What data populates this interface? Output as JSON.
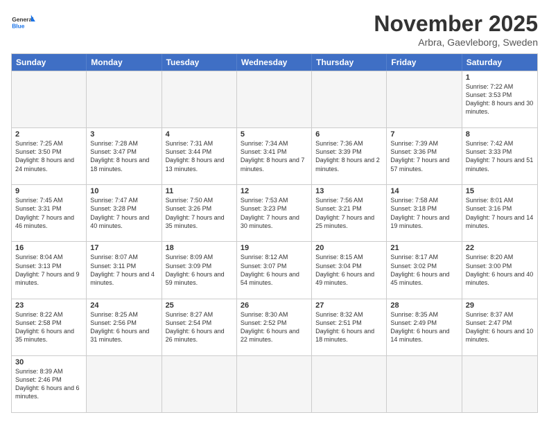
{
  "logo": {
    "text_general": "General",
    "text_blue": "Blue"
  },
  "header": {
    "month": "November 2025",
    "location": "Arbra, Gaevleborg, Sweden"
  },
  "days_of_week": [
    "Sunday",
    "Monday",
    "Tuesday",
    "Wednesday",
    "Thursday",
    "Friday",
    "Saturday"
  ],
  "weeks": [
    [
      {
        "day": "",
        "info": "",
        "empty": true
      },
      {
        "day": "",
        "info": "",
        "empty": true
      },
      {
        "day": "",
        "info": "",
        "empty": true
      },
      {
        "day": "",
        "info": "",
        "empty": true
      },
      {
        "day": "",
        "info": "",
        "empty": true
      },
      {
        "day": "",
        "info": "",
        "empty": true
      },
      {
        "day": "1",
        "info": "Sunrise: 7:22 AM\nSunset: 3:53 PM\nDaylight: 8 hours\nand 30 minutes.",
        "empty": false
      }
    ],
    [
      {
        "day": "2",
        "info": "Sunrise: 7:25 AM\nSunset: 3:50 PM\nDaylight: 8 hours\nand 24 minutes.",
        "empty": false
      },
      {
        "day": "3",
        "info": "Sunrise: 7:28 AM\nSunset: 3:47 PM\nDaylight: 8 hours\nand 18 minutes.",
        "empty": false
      },
      {
        "day": "4",
        "info": "Sunrise: 7:31 AM\nSunset: 3:44 PM\nDaylight: 8 hours\nand 13 minutes.",
        "empty": false
      },
      {
        "day": "5",
        "info": "Sunrise: 7:34 AM\nSunset: 3:41 PM\nDaylight: 8 hours\nand 7 minutes.",
        "empty": false
      },
      {
        "day": "6",
        "info": "Sunrise: 7:36 AM\nSunset: 3:39 PM\nDaylight: 8 hours\nand 2 minutes.",
        "empty": false
      },
      {
        "day": "7",
        "info": "Sunrise: 7:39 AM\nSunset: 3:36 PM\nDaylight: 7 hours\nand 57 minutes.",
        "empty": false
      },
      {
        "day": "8",
        "info": "Sunrise: 7:42 AM\nSunset: 3:33 PM\nDaylight: 7 hours\nand 51 minutes.",
        "empty": false
      }
    ],
    [
      {
        "day": "9",
        "info": "Sunrise: 7:45 AM\nSunset: 3:31 PM\nDaylight: 7 hours\nand 46 minutes.",
        "empty": false
      },
      {
        "day": "10",
        "info": "Sunrise: 7:47 AM\nSunset: 3:28 PM\nDaylight: 7 hours\nand 40 minutes.",
        "empty": false
      },
      {
        "day": "11",
        "info": "Sunrise: 7:50 AM\nSunset: 3:26 PM\nDaylight: 7 hours\nand 35 minutes.",
        "empty": false
      },
      {
        "day": "12",
        "info": "Sunrise: 7:53 AM\nSunset: 3:23 PM\nDaylight: 7 hours\nand 30 minutes.",
        "empty": false
      },
      {
        "day": "13",
        "info": "Sunrise: 7:56 AM\nSunset: 3:21 PM\nDaylight: 7 hours\nand 25 minutes.",
        "empty": false
      },
      {
        "day": "14",
        "info": "Sunrise: 7:58 AM\nSunset: 3:18 PM\nDaylight: 7 hours\nand 19 minutes.",
        "empty": false
      },
      {
        "day": "15",
        "info": "Sunrise: 8:01 AM\nSunset: 3:16 PM\nDaylight: 7 hours\nand 14 minutes.",
        "empty": false
      }
    ],
    [
      {
        "day": "16",
        "info": "Sunrise: 8:04 AM\nSunset: 3:13 PM\nDaylight: 7 hours\nand 9 minutes.",
        "empty": false
      },
      {
        "day": "17",
        "info": "Sunrise: 8:07 AM\nSunset: 3:11 PM\nDaylight: 7 hours\nand 4 minutes.",
        "empty": false
      },
      {
        "day": "18",
        "info": "Sunrise: 8:09 AM\nSunset: 3:09 PM\nDaylight: 6 hours\nand 59 minutes.",
        "empty": false
      },
      {
        "day": "19",
        "info": "Sunrise: 8:12 AM\nSunset: 3:07 PM\nDaylight: 6 hours\nand 54 minutes.",
        "empty": false
      },
      {
        "day": "20",
        "info": "Sunrise: 8:15 AM\nSunset: 3:04 PM\nDaylight: 6 hours\nand 49 minutes.",
        "empty": false
      },
      {
        "day": "21",
        "info": "Sunrise: 8:17 AM\nSunset: 3:02 PM\nDaylight: 6 hours\nand 45 minutes.",
        "empty": false
      },
      {
        "day": "22",
        "info": "Sunrise: 8:20 AM\nSunset: 3:00 PM\nDaylight: 6 hours\nand 40 minutes.",
        "empty": false
      }
    ],
    [
      {
        "day": "23",
        "info": "Sunrise: 8:22 AM\nSunset: 2:58 PM\nDaylight: 6 hours\nand 35 minutes.",
        "empty": false
      },
      {
        "day": "24",
        "info": "Sunrise: 8:25 AM\nSunset: 2:56 PM\nDaylight: 6 hours\nand 31 minutes.",
        "empty": false
      },
      {
        "day": "25",
        "info": "Sunrise: 8:27 AM\nSunset: 2:54 PM\nDaylight: 6 hours\nand 26 minutes.",
        "empty": false
      },
      {
        "day": "26",
        "info": "Sunrise: 8:30 AM\nSunset: 2:52 PM\nDaylight: 6 hours\nand 22 minutes.",
        "empty": false
      },
      {
        "day": "27",
        "info": "Sunrise: 8:32 AM\nSunset: 2:51 PM\nDaylight: 6 hours\nand 18 minutes.",
        "empty": false
      },
      {
        "day": "28",
        "info": "Sunrise: 8:35 AM\nSunset: 2:49 PM\nDaylight: 6 hours\nand 14 minutes.",
        "empty": false
      },
      {
        "day": "29",
        "info": "Sunrise: 8:37 AM\nSunset: 2:47 PM\nDaylight: 6 hours\nand 10 minutes.",
        "empty": false
      }
    ],
    [
      {
        "day": "30",
        "info": "Sunrise: 8:39 AM\nSunset: 2:46 PM\nDaylight: 6 hours\nand 6 minutes.",
        "empty": false
      },
      {
        "day": "",
        "info": "",
        "empty": true
      },
      {
        "day": "",
        "info": "",
        "empty": true
      },
      {
        "day": "",
        "info": "",
        "empty": true
      },
      {
        "day": "",
        "info": "",
        "empty": true
      },
      {
        "day": "",
        "info": "",
        "empty": true
      },
      {
        "day": "",
        "info": "",
        "empty": true
      }
    ]
  ]
}
